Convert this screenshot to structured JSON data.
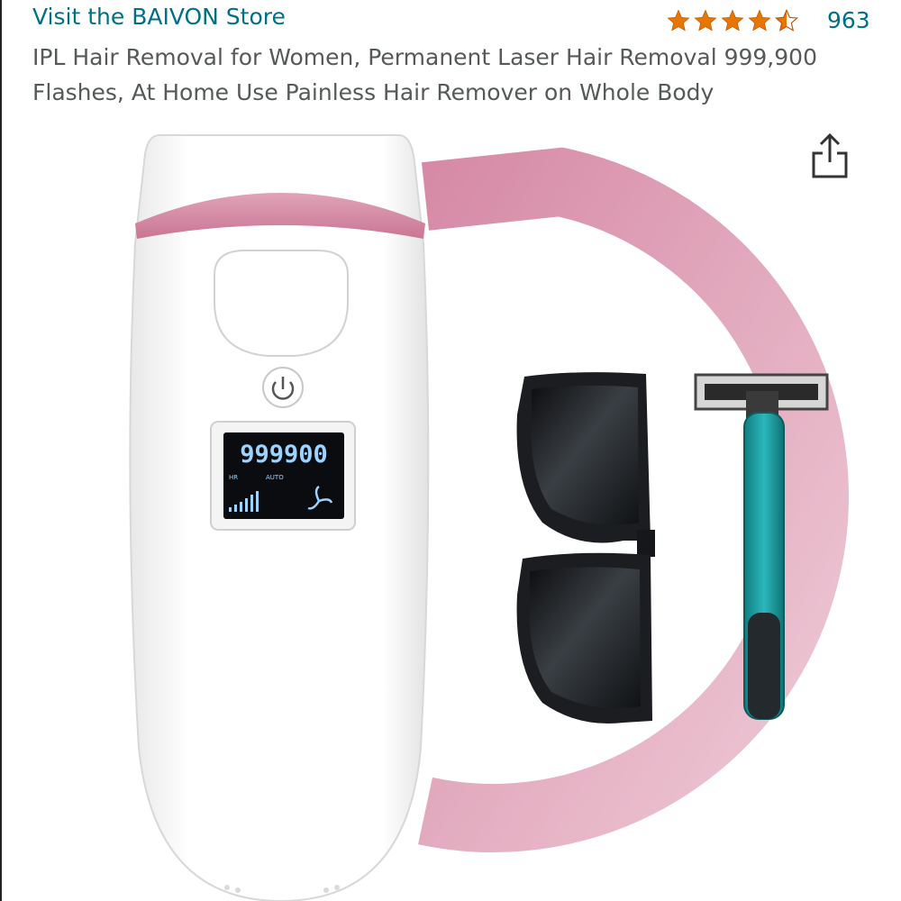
{
  "header": {
    "store_link": "Visit the BAIVON Store",
    "rating": {
      "stars": 4.5,
      "max": 5,
      "count": "963",
      "star_color": "#e77600"
    },
    "title": "IPL Hair Removal for Women, Permanent Laser Hair Removal 999,900 Flashes, At Home Use Painless Hair Remover on Whole Body"
  },
  "share_icon": "share-icon",
  "product_image": {
    "device_display": {
      "count": "999900",
      "mode_left": "HR",
      "mode_right": "AUTO"
    },
    "colors": {
      "accent_pink": "#d98aa6",
      "razor_teal": "#1fa3a8",
      "link": "#007185"
    }
  }
}
